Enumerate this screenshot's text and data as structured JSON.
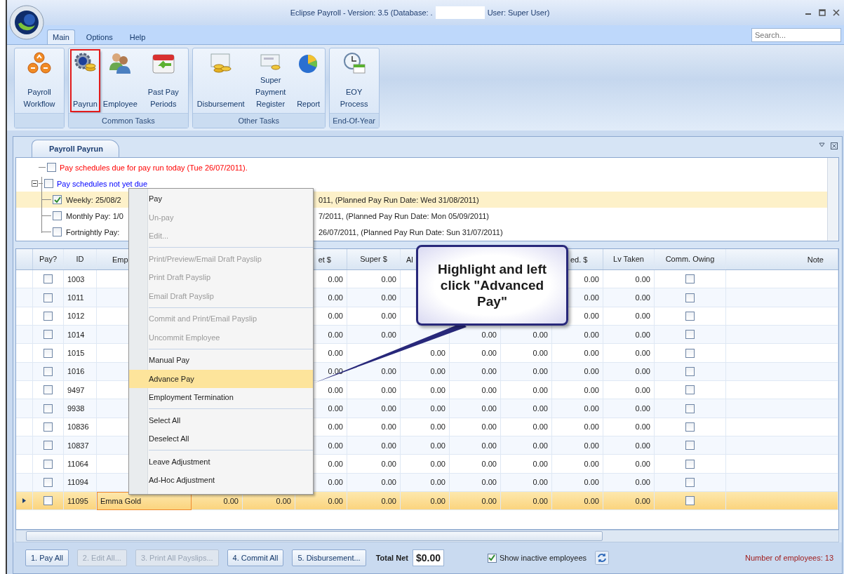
{
  "window": {
    "title": "Eclipse Payroll - Version: 3.5 (Database: .",
    "title_end": "User: Super User)"
  },
  "ribbon_tabs": [
    {
      "label": "Main",
      "selected": true
    },
    {
      "label": "Options",
      "selected": false
    },
    {
      "label": "Help",
      "selected": false
    }
  ],
  "search": {
    "placeholder": "Search..."
  },
  "ribbon_groups": [
    {
      "buttons": [
        {
          "label": "Payroll Workflow",
          "highlighted": false
        }
      ]
    },
    {
      "label": "Common Tasks",
      "buttons": [
        {
          "label": "Payrun",
          "highlighted": true
        },
        {
          "label": "Employee",
          "highlighted": false
        },
        {
          "label": "Past Pay Periods",
          "highlighted": false
        }
      ]
    },
    {
      "label": "Other Tasks",
      "buttons": [
        {
          "label": "Disbursement",
          "highlighted": false
        },
        {
          "label": "Super Payment Register",
          "highlighted": false
        },
        {
          "label": "Report",
          "highlighted": false
        }
      ]
    },
    {
      "label": "End-Of-Year",
      "buttons": [
        {
          "label": "EOY Process",
          "highlighted": false
        }
      ]
    }
  ],
  "document_tab": {
    "label": "Payroll Payrun"
  },
  "schedule_tree": [
    {
      "label": "Pay schedules due for pay run today (Tue 26/07/2011).",
      "color": "#ff0000",
      "checked": false
    },
    {
      "label": "Pay schedules not yet due",
      "color": "#0000ff",
      "checked": false,
      "expanded": true,
      "children": [
        {
          "label_start": "Weekly: 25/08/2",
          "label_end": "011,  (Planned Pay Run Date: Wed 31/08/2011)",
          "checked": true,
          "selected": true
        },
        {
          "label_start": "Monthly Pay: 1/0",
          "label_end": "7/2011,  (Planned Pay Run Date: Mon 05/09/2011)",
          "checked": false,
          "selected": false
        },
        {
          "label_start": "Fortnightly Pay:",
          "label_end": "26/07/2011,  (Planned Pay Run Date: Sun 31/07/2011)",
          "checked": false,
          "selected": false
        }
      ]
    }
  ],
  "grid": {
    "columns": {
      "pay": "Pay?",
      "id": "ID",
      "column_3": "Emp",
      "column_6": "et $",
      "column_7": "Super $",
      "column_8": "Al",
      "column_11": "ed. $",
      "column_12": "Lv Taken",
      "column_13": "Comm. Owing",
      "column_14": "Note"
    },
    "rows": [
      {
        "pay": false,
        "id": "1003",
        "column_6": "0.00",
        "column_7": "0.00",
        "column_11": "0.00",
        "column_12": "0.00",
        "comm_owing": false,
        "selected": false
      },
      {
        "pay": false,
        "id": "1011",
        "column_6": "0.00",
        "column_7": "0.00",
        "column_11": "0.00",
        "column_12": "0.00",
        "comm_owing": false,
        "selected": false
      },
      {
        "pay": false,
        "id": "1012",
        "column_6": "0.00",
        "column_7": "0.00",
        "column_11": "0.00",
        "column_12": "0.00",
        "comm_owing": false,
        "selected": false
      },
      {
        "pay": false,
        "id": "1014",
        "column_6": "0.00",
        "column_7": "0.00",
        "column_9": "0.00",
        "column_10": "0.00",
        "column_11": "0.00",
        "column_12": "0.00",
        "comm_owing": false,
        "selected": false
      },
      {
        "pay": false,
        "id": "1015",
        "column_6": "0.00",
        "column_8": "0.00",
        "column_9": "0.00",
        "column_10": "0.00",
        "column_11": "0.00",
        "column_12": "0.00",
        "comm_owing": false,
        "selected": false
      },
      {
        "pay": false,
        "id": "1016",
        "column_6": "0.00",
        "column_7": "0.00",
        "column_8": "0.00",
        "column_9": "0.00",
        "column_10": "0.00",
        "column_11": "0.00",
        "column_12": "0.00",
        "comm_owing": false,
        "selected": false
      },
      {
        "pay": false,
        "id": "9497",
        "column_6": "0.00",
        "column_7": "0.00",
        "column_8": "0.00",
        "column_9": "0.00",
        "column_10": "0.00",
        "column_11": "0.00",
        "column_12": "0.00",
        "comm_owing": false,
        "selected": false
      },
      {
        "pay": false,
        "id": "9938",
        "column_6": "0.00",
        "column_7": "0.00",
        "column_8": "0.00",
        "column_9": "0.00",
        "column_10": "0.00",
        "column_11": "0.00",
        "column_12": "0.00",
        "comm_owing": false,
        "selected": false
      },
      {
        "pay": false,
        "id": "10836",
        "column_6": "0.00",
        "column_7": "0.00",
        "column_8": "0.00",
        "column_9": "0.00",
        "column_10": "0.00",
        "column_11": "0.00",
        "column_12": "0.00",
        "comm_owing": false,
        "selected": false
      },
      {
        "pay": false,
        "id": "10837",
        "column_6": "0.00",
        "column_7": "0.00",
        "column_8": "0.00",
        "column_9": "0.00",
        "column_10": "0.00",
        "column_11": "0.00",
        "column_12": "0.00",
        "comm_owing": false,
        "selected": false
      },
      {
        "pay": false,
        "id": "11064",
        "column_6": "0.00",
        "column_7": "0.00",
        "column_8": "0.00",
        "column_9": "0.00",
        "column_10": "0.00",
        "column_11": "0.00",
        "column_12": "0.00",
        "comm_owing": false,
        "selected": false
      },
      {
        "pay": false,
        "id": "11094",
        "column_6": "0.00",
        "column_7": "0.00",
        "column_8": "0.00",
        "column_9": "0.00",
        "column_10": "0.00",
        "column_11": "0.00",
        "column_12": "0.00",
        "comm_owing": false,
        "selected": false
      },
      {
        "pay": false,
        "id": "11095",
        "column_3": "Emma Gold",
        "column_4": "0.00",
        "column_5": "0.00",
        "column_6": "0.00",
        "column_7": "0.00",
        "column_8": "0.00",
        "column_9": "0.00",
        "column_10": "0.00",
        "column_11": "0.00",
        "column_12": "0.00",
        "comm_owing": false,
        "selected": true
      }
    ]
  },
  "context_menu": {
    "groups": [
      [
        {
          "label": "Pay",
          "disabled": false,
          "selected": false
        },
        {
          "label": "Un-pay",
          "disabled": true,
          "selected": false
        },
        {
          "label": "Edit...",
          "disabled": true,
          "selected": false
        }
      ],
      [
        {
          "label": "Print/Preview/Email Draft Payslip",
          "disabled": true,
          "selected": false
        },
        {
          "label": "Print Draft Payslip",
          "disabled": true,
          "selected": false
        },
        {
          "label": "Email Draft Payslip",
          "disabled": true,
          "selected": false
        }
      ],
      [
        {
          "label": "Commit and Print/Email Payslip",
          "disabled": true,
          "selected": false
        },
        {
          "label": "Uncommit Employee",
          "disabled": true,
          "selected": false
        }
      ],
      [
        {
          "label": "Manual Pay",
          "disabled": false,
          "selected": false
        },
        {
          "label": "Advance Pay",
          "disabled": false,
          "selected": true
        },
        {
          "label": "Employment Termination",
          "disabled": false,
          "selected": false
        }
      ],
      [
        {
          "label": "Select All",
          "disabled": false,
          "selected": false
        },
        {
          "label": "Deselect All",
          "disabled": false,
          "selected": false
        }
      ],
      [
        {
          "label": "Leave Adjustment",
          "disabled": false,
          "selected": false
        },
        {
          "label": "Ad-Hoc Adjustment",
          "disabled": false,
          "selected": false
        }
      ]
    ]
  },
  "callout": {
    "text": "Highlight and left click \"Advanced Pay\""
  },
  "bottom_buttons": [
    {
      "label": "1. Pay All",
      "disabled": false
    },
    {
      "label": "2. Edit All...",
      "disabled": true
    },
    {
      "label": "3. Print All Payslips...",
      "disabled": true
    },
    {
      "label": "4. Commit All",
      "disabled": false
    },
    {
      "label": "5. Disbursement...",
      "disabled": false
    }
  ],
  "total_net": {
    "label": "Total Net",
    "value": "$0.00"
  },
  "show_inactive": {
    "label": "Show inactive employees",
    "checked": true
  },
  "employee_count": "Number of employees: 13"
}
